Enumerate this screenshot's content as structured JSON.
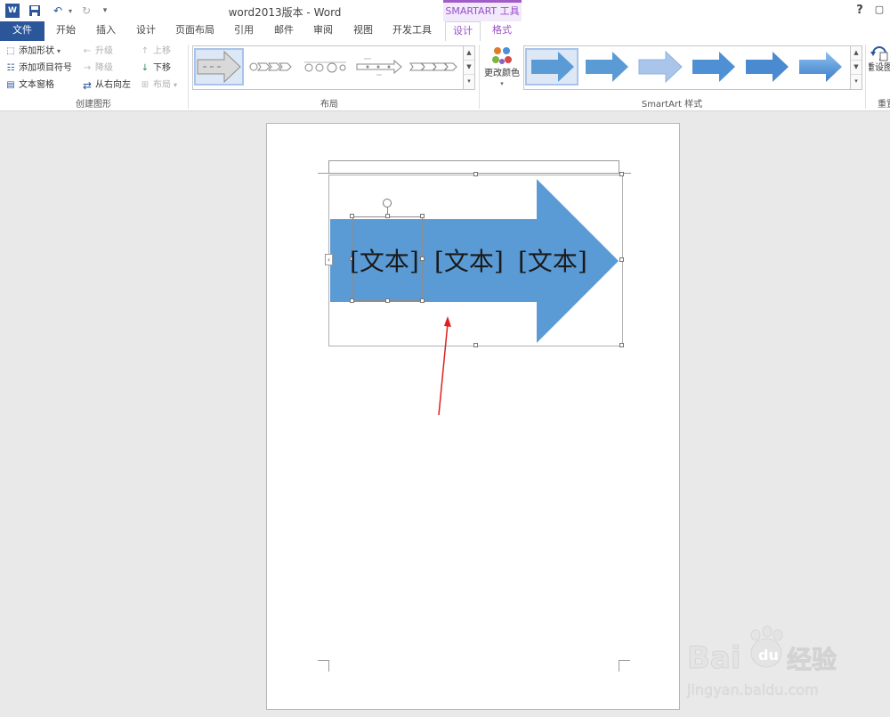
{
  "titlebar": {
    "title": "word2013版本 - Word",
    "context_band": "SMARTART 工具",
    "help": "?",
    "restore": "▢"
  },
  "tabs": [
    {
      "label": "文件",
      "kind": "file"
    },
    {
      "label": "开始"
    },
    {
      "label": "插入"
    },
    {
      "label": "设计"
    },
    {
      "label": "页面布局"
    },
    {
      "label": "引用"
    },
    {
      "label": "邮件"
    },
    {
      "label": "审阅"
    },
    {
      "label": "视图"
    },
    {
      "label": "开发工具"
    },
    {
      "label": "设计",
      "kind": "active"
    },
    {
      "label": "格式",
      "kind": "ctx"
    }
  ],
  "ribbon": {
    "create": {
      "add_shape": "添加形状",
      "add_bullet": "添加项目符号",
      "text_pane": "文本窗格",
      "promote": "升级",
      "demote": "降级",
      "right_to_left": "从右向左",
      "move_up": "上移",
      "move_down": "下移",
      "layout": "布局",
      "group_label": "创建图形"
    },
    "layout_group_label": "布局",
    "change_colors": "更改颜色",
    "styles_group_label": "SmartArt 样式",
    "reset": "重设图",
    "reset_group_label": "重置"
  },
  "document": {
    "smartart_texts": [
      "[文本]",
      "[文本]",
      "[文本]"
    ]
  },
  "colors": {
    "accent": "#2b579a",
    "context": "#9a4fc6",
    "arrow": "#5b9bd5"
  },
  "watermark": {
    "brand": "Baidu经验",
    "url": "jingyan.baidu.com"
  }
}
